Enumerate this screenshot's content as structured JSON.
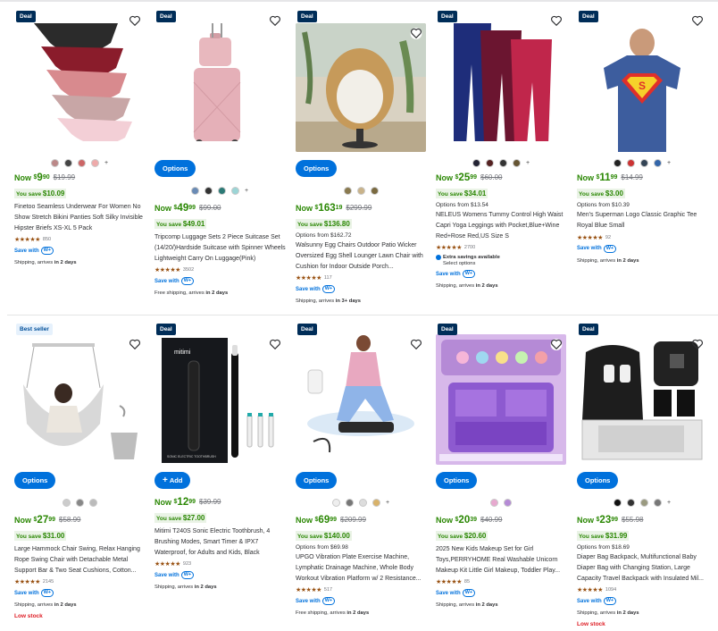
{
  "colors": {
    "accent": "#0071dc",
    "price": "#2a8703",
    "deal_badge": "#002d58",
    "low_stock": "#de1c24"
  },
  "products": [
    {
      "badge": "Deal",
      "now": "Now",
      "dollars": "9",
      "cents": "90",
      "was": "$19.99",
      "save_label": "You save",
      "save_amount": "$10.09",
      "title": "Finetoo Seamless Underwear For Women No Show Stretch Bikini Panties Soft Silky Invisible Hipster Briefs XS-XL 5 Pack",
      "reviews": "850",
      "save_with": "Save with",
      "wplus": "W+",
      "ship_prefix": "Shipping, arrives",
      "ship_bold": " in 2 days"
    },
    {
      "badge": "Deal",
      "button": "Options",
      "now": "Now",
      "dollars": "49",
      "cents": "99",
      "was": "$99.00",
      "save_label": "You save",
      "save_amount": "$49.01",
      "title": "Tripcomp Luggage Sets 2 Piece Suitcase Set (14/20/)Hardside Suitcase with Spinner Wheels Lightweight Carry On Luggage(Pink)",
      "reviews": "3502",
      "save_with": "Save with",
      "wplus": "W+",
      "ship_prefix": "Free shipping, arrives",
      "ship_bold": " in 2 days"
    },
    {
      "badge": "Deal",
      "button": "Options",
      "now": "Now",
      "dollars": "163",
      "cents": "19",
      "was": "$299.99",
      "save_label": "You save",
      "save_amount": "$136.80",
      "options_from": "Options from $162.72",
      "title": "Walsunny Egg Chairs Outdoor Patio Wicker Oversized Egg Shell Lounger Lawn Chair with Cushion for Indoor Outside Porch...",
      "reviews": "117",
      "save_with": "Save with",
      "wplus": "W+",
      "ship_prefix": "Shipping, arrives",
      "ship_bold": " in 3+ days"
    },
    {
      "badge": "Deal",
      "now": "Now",
      "dollars": "25",
      "cents": "99",
      "was": "$60.00",
      "save_label": "You save",
      "save_amount": "$34.01",
      "options_from": "Options from $13.54",
      "title": "NELEUS Womens Tummy Control High Waist Capri Yoga Leggings with Pocket,Blue+Wine Red+Rose Red,US Size S",
      "reviews": "2700",
      "extra": "Extra savings available",
      "select": "Select options",
      "save_with": "Save with",
      "wplus": "W+",
      "ship_prefix": "Shipping, arrives",
      "ship_bold": " in 2 days"
    },
    {
      "badge": "Deal",
      "now": "Now",
      "dollars": "11",
      "cents": "99",
      "was": "$14.99",
      "save_label": "You save",
      "save_amount": "$3.00",
      "options_from": "Options from $10.39",
      "title": "Men's Superman Logo Classic Graphic Tee Royal Blue Small",
      "reviews": "92",
      "save_with": "Save with",
      "wplus": "W+",
      "ship_prefix": "Shipping, arrives",
      "ship_bold": " in 2 days"
    },
    {
      "badge": "Best seller",
      "button": "Options",
      "now": "Now",
      "dollars": "27",
      "cents": "99",
      "was": "$58.99",
      "save_label": "You save",
      "save_amount": "$31.00",
      "title": "Large Hammock Chair Swing, Relax Hanging Rope Swing Chair with Detachable Metal Support Bar & Two Seat Cushions, Cotton...",
      "reviews": "2145",
      "save_with": "Save with",
      "wplus": "W+",
      "ship_prefix": "Shipping, arrives",
      "ship_bold": " in 2 days",
      "low_stock": "Low stock"
    },
    {
      "badge": "Deal",
      "button": "Add",
      "now": "Now",
      "dollars": "12",
      "cents": "99",
      "was": "$39.99",
      "save_label": "You save",
      "save_amount": "$27.00",
      "title": "Mitimi T240S Sonic Electric Toothbrush, 4 Brushing Modes, Smart Timer & IPX7 Waterproof, for Adults and Kids, Black",
      "reviews": "923",
      "save_with": "Save with",
      "wplus": "W+",
      "ship_prefix": "Shipping, arrives",
      "ship_bold": " in 2 days"
    },
    {
      "badge": "Deal",
      "button": "Options",
      "now": "Now",
      "dollars": "69",
      "cents": "99",
      "was": "$209.99",
      "save_label": "You save",
      "save_amount": "$140.00",
      "options_from": "Options from $69.98",
      "title": "UPGO Vibration Plate Exercise Machine, Lymphatic Drainage Machine, Whole Body Workout Vibration Platform w/ 2 Resistance...",
      "reviews": "517",
      "save_with": "Save with",
      "wplus": "W+",
      "ship_prefix": "Free shipping, arrives",
      "ship_bold": " in 2 days"
    },
    {
      "badge": "Deal",
      "button": "Options",
      "now": "Now",
      "dollars": "20",
      "cents": "39",
      "was": "$40.99",
      "save_label": "You save",
      "save_amount": "$20.60",
      "title": "2025 New Kids Makeup Set for Girl Toys,PERRYHOME Real Washable Unicorn Makeup Kit Little Girl Makeup, Toddler Play...",
      "reviews": "85",
      "save_with": "Save with",
      "wplus": "W+",
      "ship_prefix": "Shipping, arrives",
      "ship_bold": " in 2 days"
    },
    {
      "badge": "Deal",
      "button": "Options",
      "now": "Now",
      "dollars": "23",
      "cents": "99",
      "was": "$55.98",
      "save_label": "You save",
      "save_amount": "$31.99",
      "options_from": "Options from $18.69",
      "title": "Diaper Bag Backpack, Multifunctional Baby Diaper Bag with Changing Station, Large Capacity Travel Backpack with Insulated Mil...",
      "reviews": "1094",
      "save_with": "Save with",
      "wplus": "W+",
      "ship_prefix": "Shipping, arrives",
      "ship_bold": " in 2 days",
      "low_stock": "Low stock"
    }
  ],
  "images": {
    "toothbrush_brand": "mitimi",
    "toothbrush_box": "SONIC ELECTRIC TOOTHBRUSH"
  }
}
